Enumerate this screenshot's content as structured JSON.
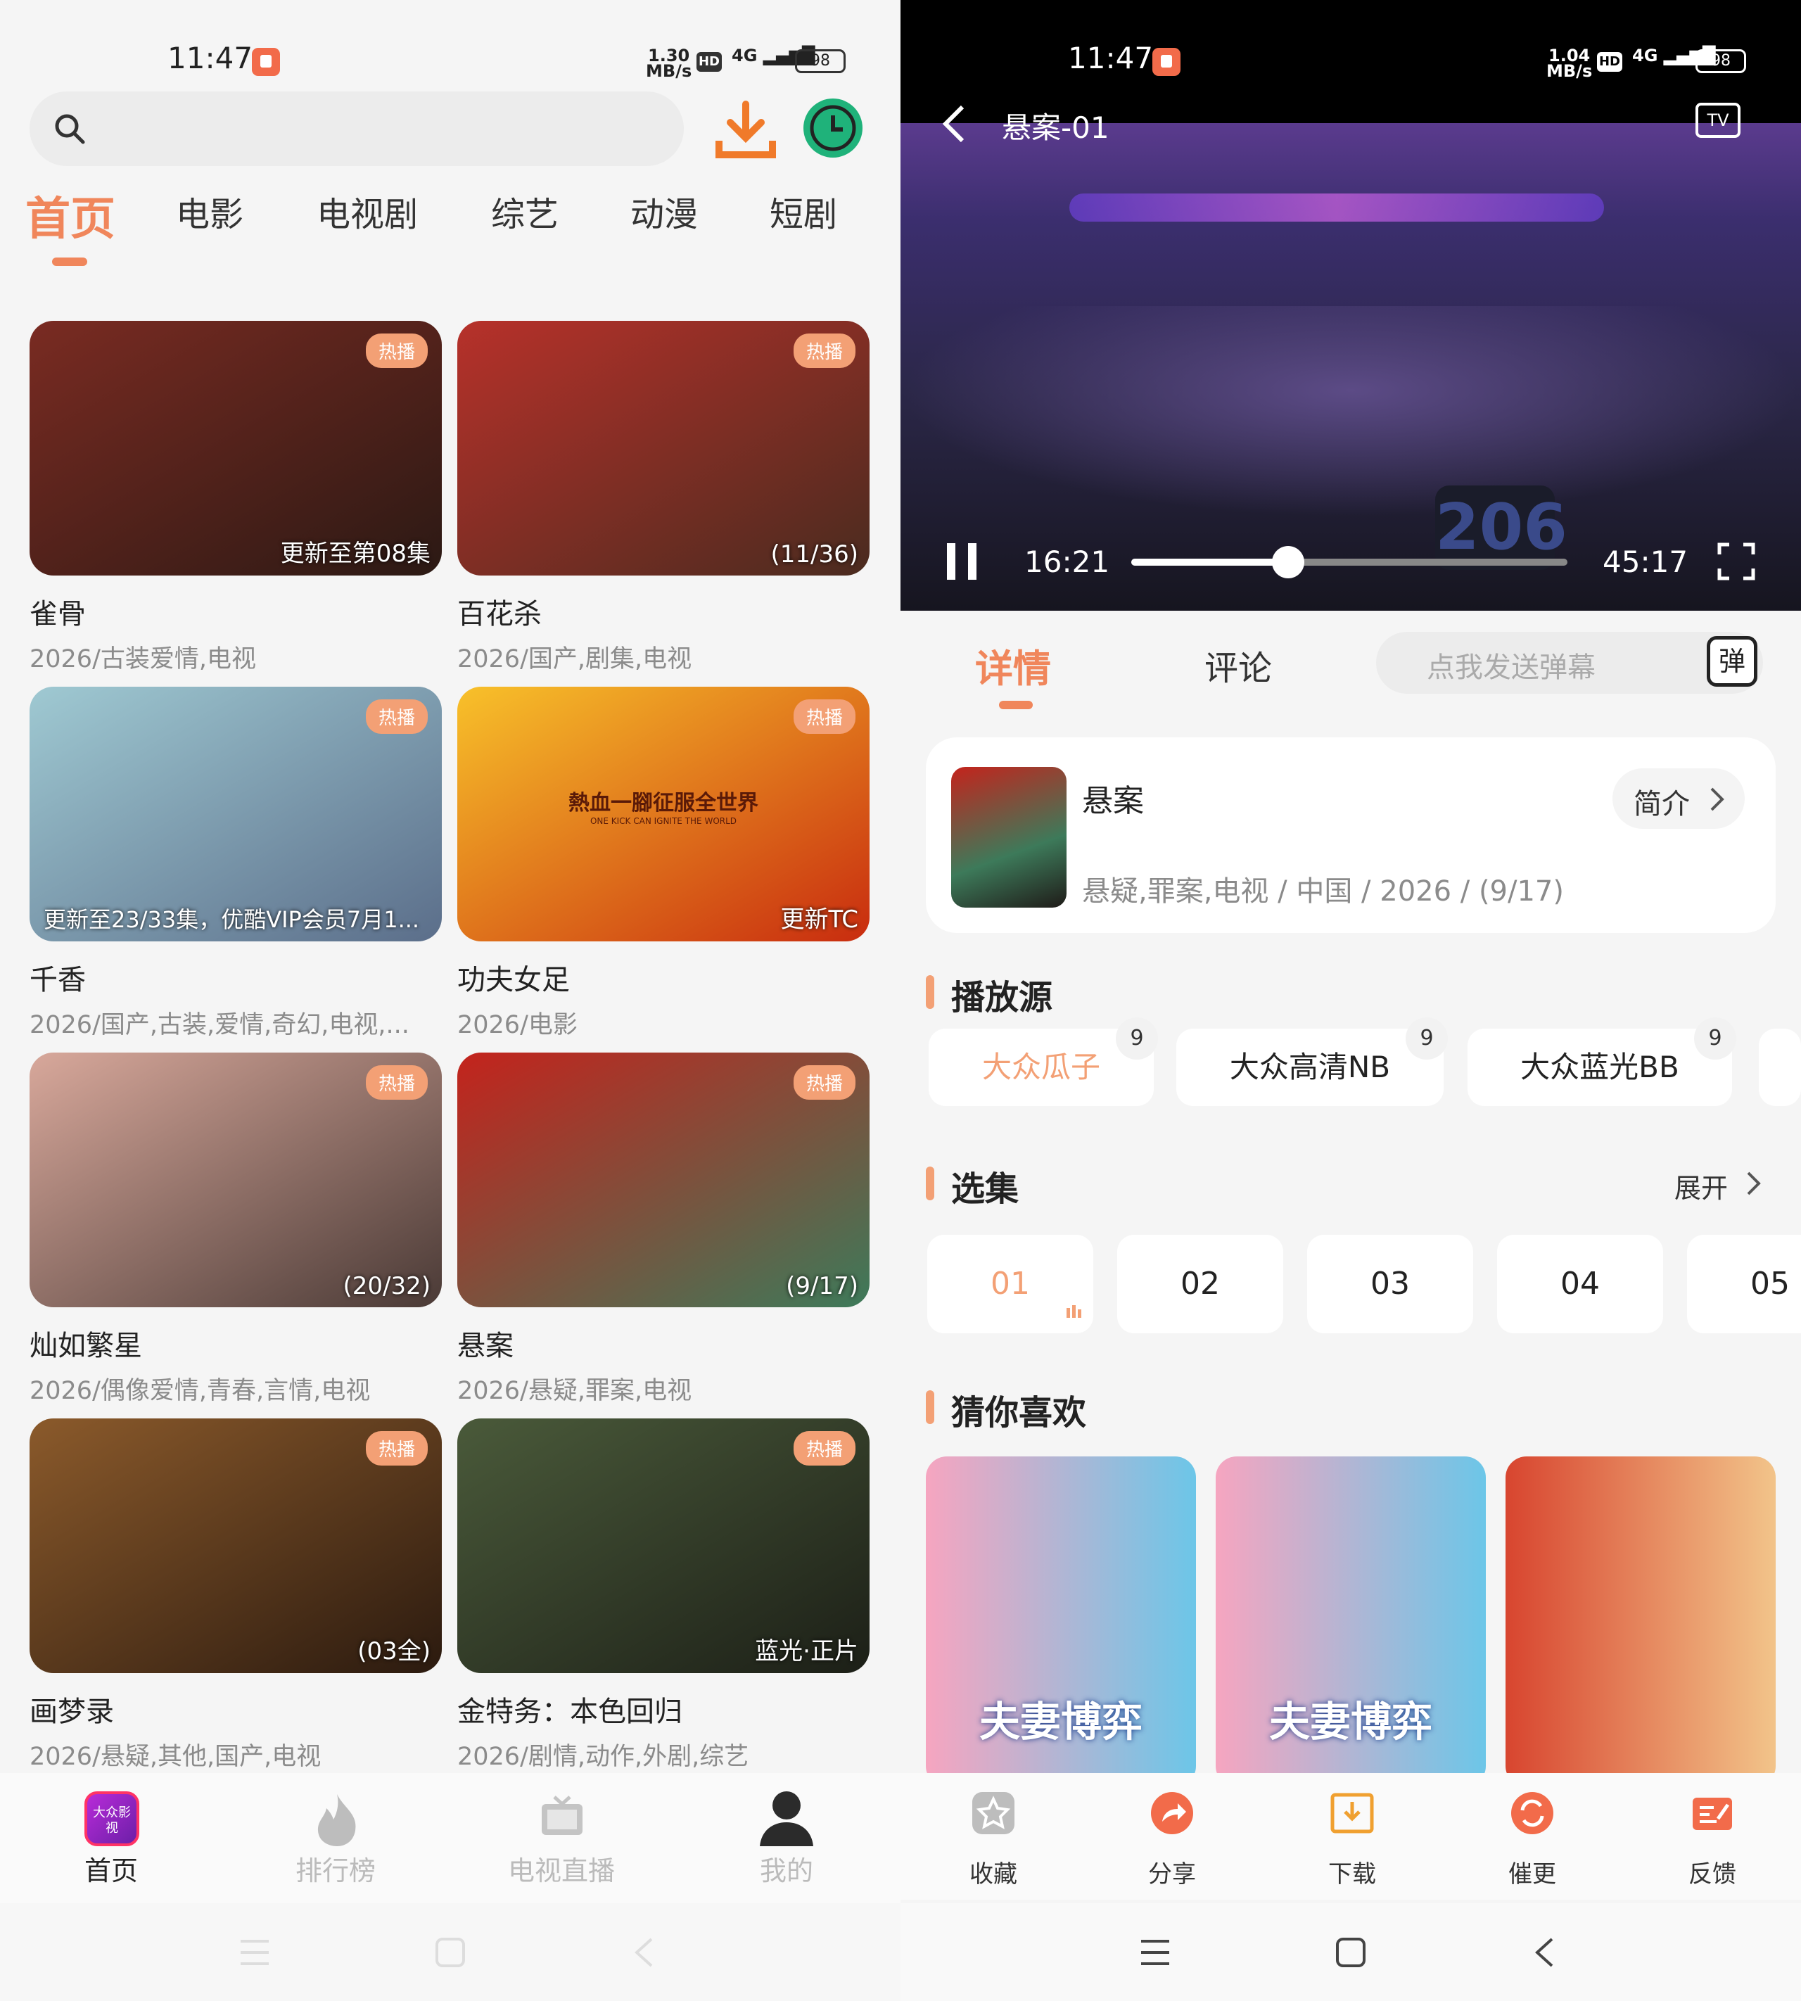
{
  "left": {
    "status": {
      "time": "11:47",
      "speed": "1.30",
      "speed_unit": "MB/s",
      "battery": "98"
    },
    "tabs": [
      "首页",
      "电影",
      "电视剧",
      "综艺",
      "动漫",
      "短剧"
    ],
    "items": [
      {
        "title": "雀骨",
        "sub": "2026/古装爱情,电视",
        "badge": "热播",
        "cap": "更新至第08集",
        "c1": "#7a2b22",
        "c2": "#2b1914"
      },
      {
        "title": "百花杀",
        "sub": "2026/国产,剧集,电视",
        "badge": "热播",
        "cap": "(11/36)",
        "c1": "#b7312a",
        "c2": "#4a2b1f"
      },
      {
        "title": "千香",
        "sub": "2026/国产,古装,爱情,奇幻,电视,...",
        "badge": "热播",
        "cap": "更新至23/33集，优酷VIP会员7月1...",
        "c1": "#9fc9d2",
        "c2": "#5b6e8a"
      },
      {
        "title": "功夫女足",
        "sub": "2026/电影",
        "badge": "热播",
        "cap": "更新TC",
        "c1": "#f8c12a",
        "c2": "#c82c0f",
        "banner": "熱血一腳征服全世界",
        "banner_en": "ONE KICK CAN IGNITE THE WORLD"
      },
      {
        "title": "灿如繁星",
        "sub": "2026/偶像爱情,青春,言情,电视",
        "badge": "热播",
        "cap": "(20/32)",
        "c1": "#d8a89b",
        "c2": "#4a3a36"
      },
      {
        "title": "悬案",
        "sub": "2026/悬疑,罪案,电视",
        "badge": "热播",
        "cap": "(9/17)",
        "c1": "#c4231c",
        "c2": "#3d7a5a"
      },
      {
        "title": "画梦录",
        "sub": "2026/悬疑,其他,国产,电视",
        "badge": "热播",
        "cap": "(03全)",
        "c1": "#8b5a2b",
        "c2": "#2b1a0f"
      },
      {
        "title": "金特务：本色回归",
        "sub": "2026/剧情,动作,外剧,综艺",
        "badge": "热播",
        "cap": "蓝光·正片",
        "c1": "#4a5a3a",
        "c2": "#1c1f17"
      }
    ],
    "nav": [
      "首页",
      "排行榜",
      "电视直播",
      "我的"
    ],
    "app_logo": "大众影视"
  },
  "right": {
    "status": {
      "time": "11:47",
      "speed": "1.04",
      "speed_unit": "MB/s",
      "battery": "98"
    },
    "player": {
      "title": "悬案-01",
      "current": "16:21",
      "total": "45:17",
      "progress": 0.36,
      "scene_text": "206",
      "watermark_icon": "tv-icon"
    },
    "tabs": {
      "detail": "详情",
      "comment": "评论",
      "danmu_placeholder": "点我发送弹幕",
      "danmu_btn": "弹"
    },
    "show": {
      "name": "悬案",
      "meta": "悬疑,罪案,电视 / 中国 / 2026 / (9/17)",
      "intro": "简介"
    },
    "sources_title": "播放源",
    "sources": [
      {
        "name": "大众瓜子",
        "count": "9"
      },
      {
        "name": "大众高清NB",
        "count": "9"
      },
      {
        "name": "大众蓝光BB",
        "count": "9"
      }
    ],
    "episodes_title": "选集",
    "expand": "展开",
    "episodes": [
      "01",
      "02",
      "03",
      "04",
      "05"
    ],
    "recommend_title": "猜你喜欢",
    "recommend": [
      {
        "text": "夫妻博弈",
        "c1": "#f6a5c0",
        "c2": "#6cc6e8"
      },
      {
        "text": "夫妻博弈",
        "c1": "#f6a5c0",
        "c2": "#6cc6e8"
      },
      {
        "text": "",
        "c1": "#d8452f",
        "c2": "#f2c48a"
      }
    ],
    "actions": [
      "收藏",
      "分享",
      "下载",
      "催更",
      "反馈"
    ],
    "colors": {
      "accent": "#f0865b",
      "action_red": "#f26b4a"
    }
  }
}
